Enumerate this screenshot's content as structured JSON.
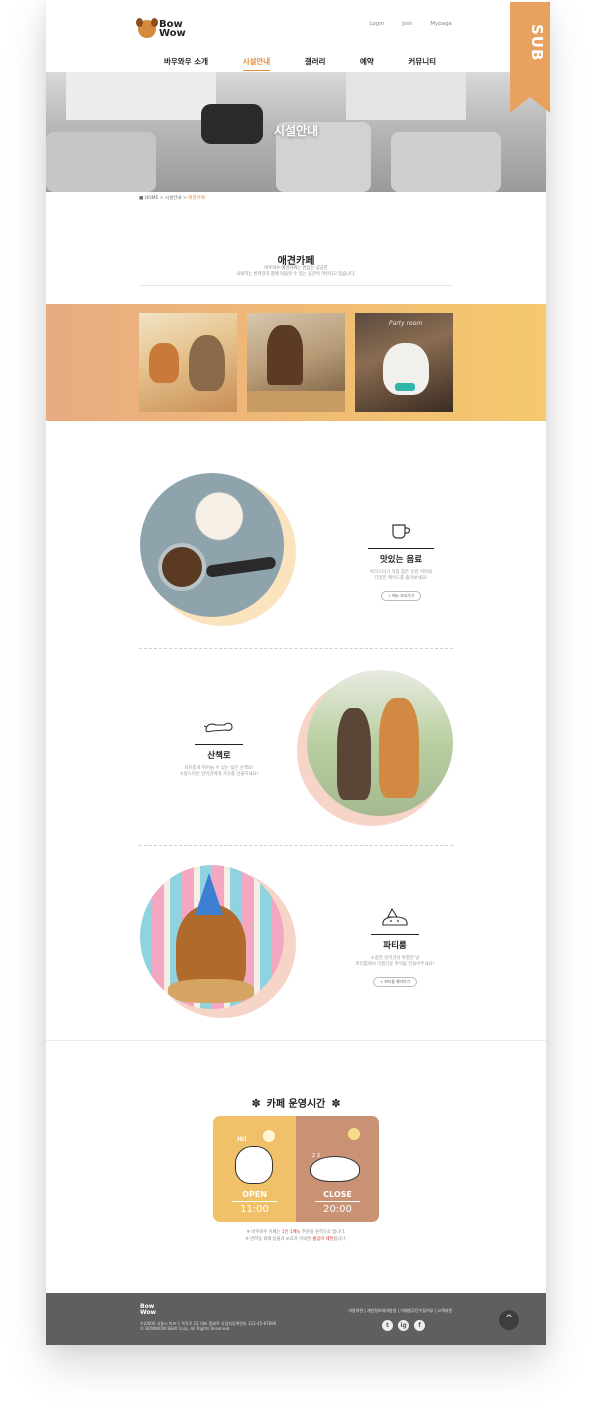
{
  "ribbon": {
    "label": "SUB"
  },
  "header": {
    "logo_line1": "Bow",
    "logo_line2": "Wow",
    "util": [
      "Login",
      "Join",
      "Mypage"
    ],
    "nav": [
      "바우와우 소개",
      "시설안내",
      "갤러리",
      "예약",
      "커뮤니티"
    ],
    "active_nav": 1
  },
  "hero": {
    "title": "시설안내"
  },
  "breadcrumb": {
    "home": "HOME",
    "sep1": ">",
    "level1": "시설안내",
    "sep2": ">",
    "current": "애견카페"
  },
  "intro": {
    "title": "애견카페",
    "desc_line1": "바우와우 애견카페는 반입는 공공한",
    "desc_line2": "사랑하는 반려견과 함께 마음껏 수 있는 공간이 마련되고 있습니다."
  },
  "gallery": {
    "captions": [
      "",
      "",
      "Party room"
    ]
  },
  "features": [
    {
      "title": "맛있는 음료",
      "desc_line1": "바리스타가 직접 뽑은 진한 커피와",
      "desc_line2": "다양한 메이드를 즐겨보세요!",
      "button": "+ 메뉴 보러가기"
    },
    {
      "title": "산책로",
      "desc_line1": "자유롭게 뛰어놀 수 있는 넓은 산책로!",
      "desc_line2": "사랑스러운 반려견에게 자유를 선물하세요!",
      "button": ""
    },
    {
      "title": "파티룸",
      "desc_line1": "소중한 반려견의 특별한 날",
      "desc_line2": "파티룸에서 아름다운 추억을 만들어주세요!",
      "button": "+ 파티룸 예약하기"
    }
  ],
  "hours": {
    "title": "카페 운영시간",
    "open_label": "OPEN",
    "open_time": "11:00",
    "close_label": "CLOSE",
    "close_time": "20:00",
    "hi_text": "Hi!",
    "note_line1_a": "※ 바우와우 카페는 ",
    "note_line1_hl": "1인 1메뉴",
    "note_line1_b": " 주문을 원칙으로 합니다.",
    "note_line2_a": "※ 반려동 외에 동물과 보호자 이외엔 ",
    "note_line2_hl": "출입이 제한",
    "note_line2_b": "됩니다."
  },
  "footer": {
    "logo_line1": "Bow",
    "logo_line2": "Wow",
    "address": "우)0000 서울시 마포구 독막로 22 대표 홍혜주 사업자등록번호 123-45-67890",
    "copyright": "© BOWWOW B&W Corp. All Rights Reserved.",
    "links": "이용약관 | 개인정보처리방침 | 이메일무단수집거부 | 고객지원",
    "sns": [
      "t",
      "ig",
      "f"
    ],
    "top_button": "^"
  },
  "colors": {
    "accent": "#e28b3a",
    "band_start": "#e8ab82",
    "band_end": "#f5c96f",
    "open_bg": "#f0c169",
    "close_bg": "#c99275",
    "footer_bg": "#5f5f5f"
  }
}
